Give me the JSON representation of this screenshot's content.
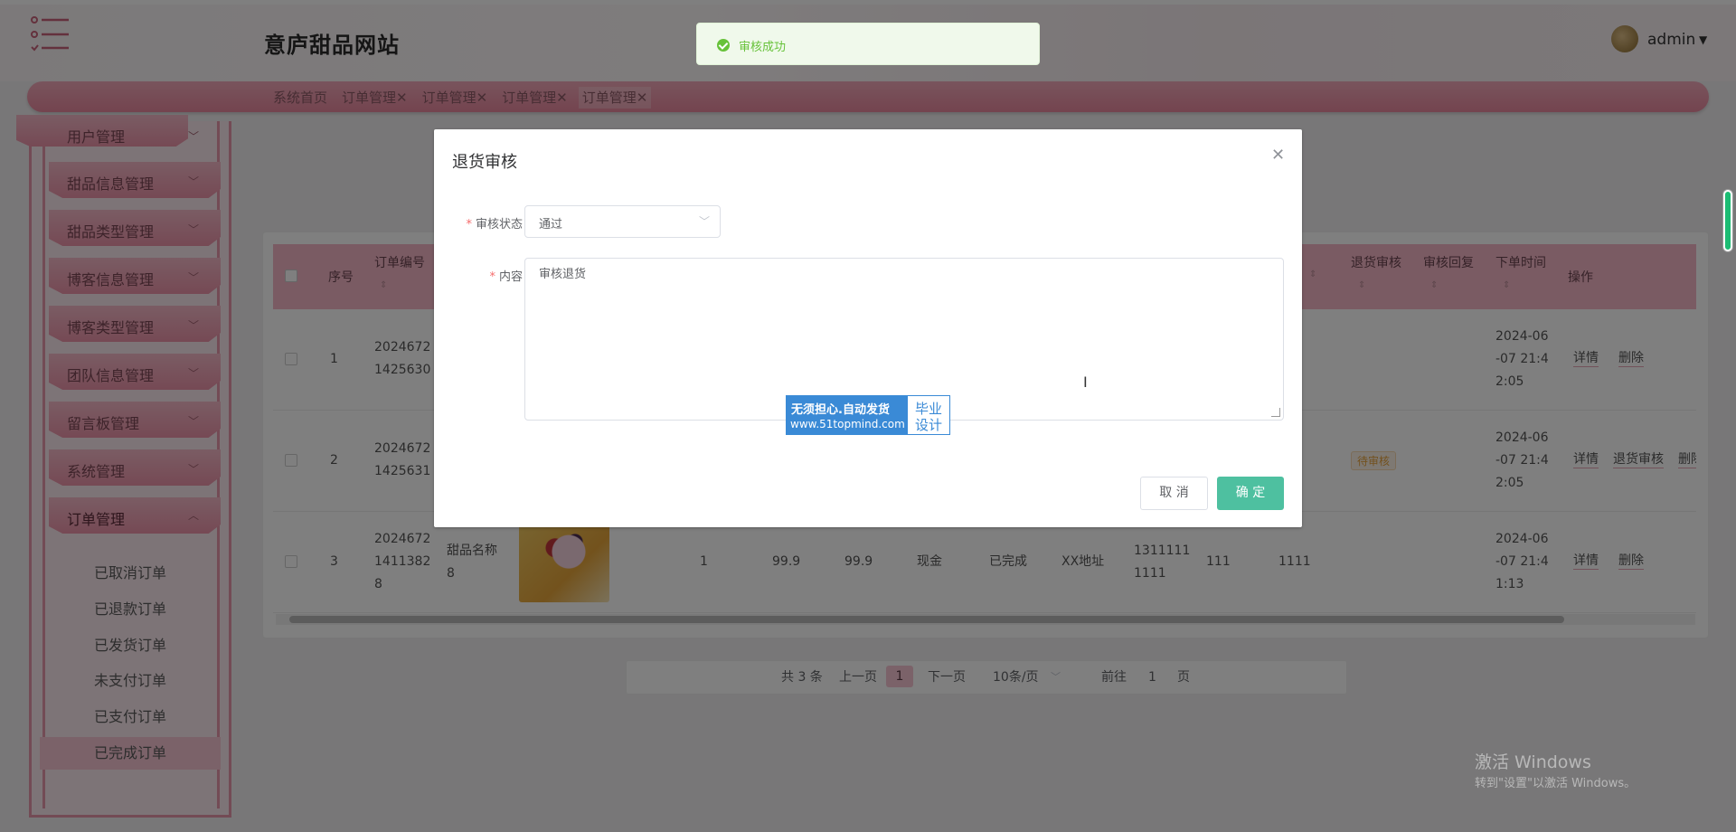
{
  "header": {
    "site_title": "意庐甜品网站",
    "user_name": "admin"
  },
  "tabs": [
    {
      "label": "系统首页"
    },
    {
      "label": "订单管理✕"
    },
    {
      "label": "订单管理✕"
    },
    {
      "label": "订单管理✕"
    },
    {
      "label": "订单管理✕"
    }
  ],
  "sidebar": {
    "items": [
      {
        "label": "用户管理"
      },
      {
        "label": "甜品信息管理"
      },
      {
        "label": "甜品类型管理"
      },
      {
        "label": "博客信息管理"
      },
      {
        "label": "博客类型管理"
      },
      {
        "label": "团队信息管理"
      },
      {
        "label": "留言板管理"
      },
      {
        "label": "系统管理"
      },
      {
        "label": "订单管理"
      }
    ],
    "sub_items": [
      {
        "label": "已取消订单"
      },
      {
        "label": "已退款订单"
      },
      {
        "label": "已发货订单"
      },
      {
        "label": "未支付订单"
      },
      {
        "label": "已支付订单"
      },
      {
        "label": "已完成订单"
      }
    ]
  },
  "table": {
    "headers": {
      "index": "序号",
      "order_no": "订单编号",
      "return_review": "退货审核",
      "review_reply": "审核回复",
      "order_time": "下单时间",
      "actions": "操作"
    },
    "rows": [
      {
        "index": "1",
        "order_no_1": "2024672",
        "order_no_2": "1425630",
        "time_1": "2024-06",
        "time_2": "-07 21:4",
        "time_3": "2:05",
        "op1": "详情",
        "op2": "删除"
      },
      {
        "index": "2",
        "order_no_1": "2024672",
        "order_no_2": "1425631",
        "badge": "待审核",
        "time_1": "2024-06",
        "time_2": "-07 21:4",
        "time_3": "2:05",
        "op1": "详情",
        "op2": "退货审核",
        "op3": "删除"
      },
      {
        "index": "3",
        "order_no_1": "2024672",
        "order_no_2": "1411382",
        "order_no_3": "8",
        "name_1": "甜品名称",
        "name_2": "8",
        "qty": "1",
        "price": "99.9",
        "total": "99.9",
        "pay": "现金",
        "status": "已完成",
        "address": "XX地址",
        "phone_1": "1311111",
        "phone_2": "1111",
        "c1": "111",
        "c2": "1111",
        "time_1": "2024-06",
        "time_2": "-07 21:4",
        "time_3": "1:13",
        "op1": "详情",
        "op2": "删除"
      }
    ]
  },
  "pagination": {
    "total": "共 3 条",
    "prev": "上一页",
    "current": "1",
    "next": "下一页",
    "page_size": "10条/页",
    "goto": "前往",
    "goto_value": "1",
    "page_unit": "页"
  },
  "toast": {
    "text": "审核成功"
  },
  "dialog": {
    "title": "退货审核",
    "status_label": "审核状态",
    "status_value": "通过",
    "content_label": "内容",
    "content_value": "审核退货",
    "cancel_label": "取 消",
    "ok_label": "确 定"
  },
  "watermark": {
    "line1": "无须担心.自动发货",
    "line2": "www.51topmind.com",
    "right1": "毕业",
    "right2": "设计"
  },
  "windows": {
    "line1": "激活 Windows",
    "line2": "转到\"设置\"以激活 Windows。"
  }
}
